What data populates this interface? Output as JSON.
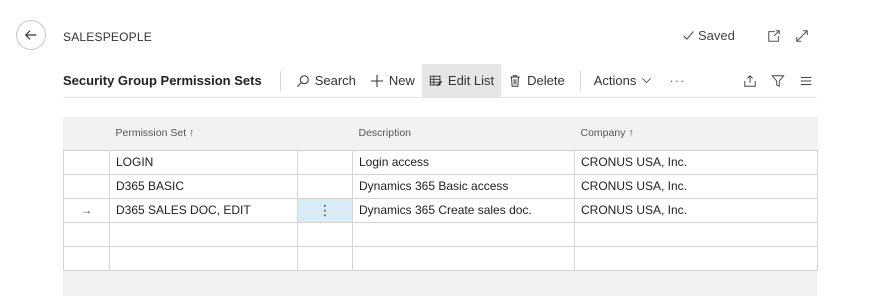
{
  "header": {
    "caption": "SALESPEOPLE",
    "saved_label": "Saved"
  },
  "actionbar": {
    "title": "Security Group Permission Sets",
    "search_label": "Search",
    "new_label": "New",
    "edit_list_label": "Edit List",
    "delete_label": "Delete",
    "actions_label": "Actions",
    "more_label": "···"
  },
  "table": {
    "columns": {
      "permission_set": "Permission Set ↑",
      "description": "Description",
      "company": "Company ↑"
    },
    "rows": [
      {
        "arrow": "",
        "permission_set": "LOGIN",
        "menu": "",
        "description": "Login access",
        "company": "CRONUS USA, Inc."
      },
      {
        "arrow": "",
        "permission_set": "D365 BASIC",
        "menu": "",
        "description": "Dynamics 365 Basic access",
        "company": "CRONUS USA, Inc."
      },
      {
        "arrow": "→",
        "permission_set": "D365 SALES DOC, EDIT",
        "menu": "⋮",
        "description": "Dynamics 365 Create sales doc.",
        "company": "CRONUS USA, Inc."
      },
      {
        "arrow": "",
        "permission_set": "",
        "menu": "",
        "description": "",
        "company": ""
      },
      {
        "arrow": "",
        "permission_set": "",
        "menu": "",
        "description": "",
        "company": ""
      }
    ]
  },
  "icons": {
    "back": "arrow-left-icon",
    "saved": "checkmark-icon",
    "open_new_window": "open-in-new-window-icon",
    "expand": "expand-icon",
    "search": "search-icon",
    "new": "plus-icon",
    "edit_list": "edit-list-icon",
    "delete": "trash-icon",
    "actions_chevron": "chevron-down-icon",
    "share": "share-icon",
    "filter": "filter-icon",
    "list_view": "list-view-icon"
  },
  "colors": {
    "focused_cell": "#d9ecf5",
    "active_button": "#e6e6e6",
    "grid_background": "#f2f2f2"
  }
}
